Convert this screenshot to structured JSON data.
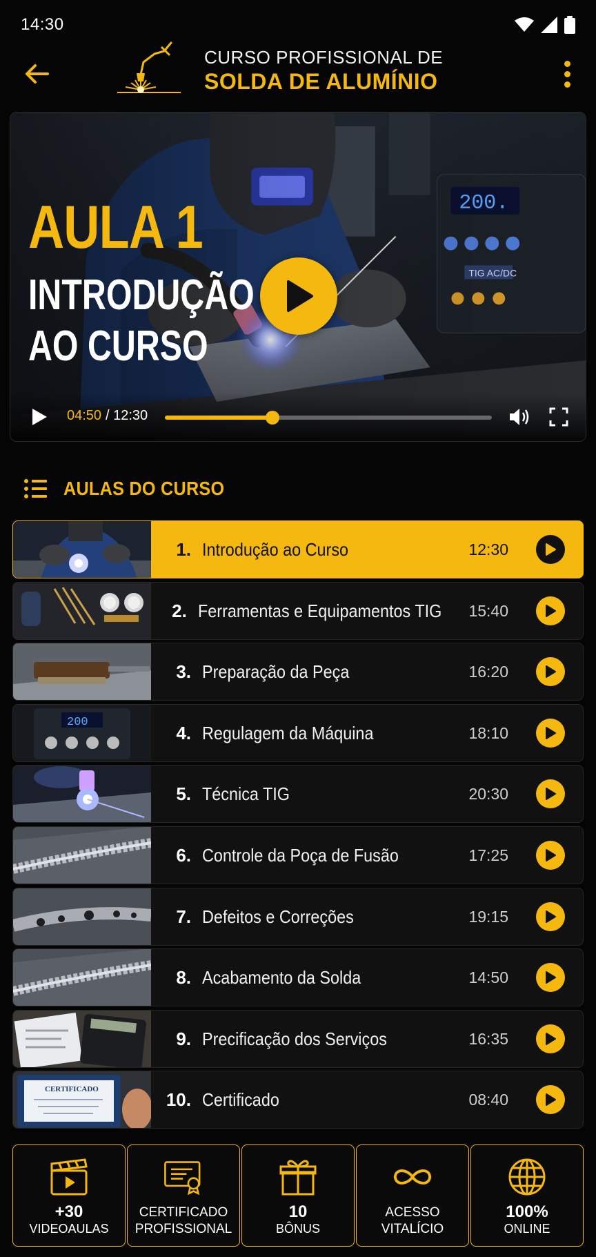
{
  "status_bar": {
    "time": "14:30"
  },
  "header": {
    "title_line1": "CURSO PROFISSIONAL DE",
    "title_line2": "SOLDA DE ALUMÍNIO"
  },
  "video": {
    "aula_label": "AULA 1",
    "subtitle_line1": "INTRODUÇÃO",
    "subtitle_line2": "AO CURSO",
    "machine_display": "200.",
    "machine_label": "TIG AC/DC",
    "current_time": "04:50",
    "time_separator_total": "/ 12:30",
    "progress": 0.33
  },
  "section": {
    "title": "AULAS DO CURSO"
  },
  "lessons": [
    {
      "num": "1.",
      "title": "Introdução ao Curso",
      "duration": "12:30",
      "active": true,
      "thumb": "welding"
    },
    {
      "num": "2.",
      "title": "Ferramentas e Equipamentos TIG",
      "duration": "15:40",
      "active": false,
      "thumb": "tools"
    },
    {
      "num": "3.",
      "title": "Preparação da Peça",
      "duration": "16:20",
      "active": false,
      "thumb": "brush"
    },
    {
      "num": "4.",
      "title": "Regulagem da Máquina",
      "duration": "18:10",
      "active": false,
      "thumb": "machine"
    },
    {
      "num": "5.",
      "title": "Técnica TIG",
      "duration": "20:30",
      "active": false,
      "thumb": "arc"
    },
    {
      "num": "6.",
      "title": "Controle da Poça de Fusão",
      "duration": "17:25",
      "active": false,
      "thumb": "bead"
    },
    {
      "num": "7.",
      "title": "Defeitos e Correções",
      "duration": "19:15",
      "active": false,
      "thumb": "defects"
    },
    {
      "num": "8.",
      "title": "Acabamento da Solda",
      "duration": "14:50",
      "active": false,
      "thumb": "bead"
    },
    {
      "num": "9.",
      "title": "Precificação dos Serviços",
      "duration": "16:35",
      "active": false,
      "thumb": "calculator"
    },
    {
      "num": "10.",
      "title": "Certificado",
      "duration": "08:40",
      "active": false,
      "thumb": "certificate"
    }
  ],
  "features": [
    {
      "big": "+30",
      "small": "VIDEOAULAS",
      "icon": "clapperboard-icon"
    },
    {
      "big": "",
      "small": "CERTIFICADO PROFISSIONAL",
      "icon": "certificate-icon"
    },
    {
      "big": "10",
      "small": "BÔNUS",
      "icon": "gift-icon"
    },
    {
      "big": "",
      "small": "ACESSO VITALÍCIO",
      "icon": "infinity-icon"
    },
    {
      "big": "100%",
      "small": "ONLINE",
      "icon": "globe-icon"
    }
  ],
  "colors": {
    "accent": "#f5b80f",
    "background": "#050505",
    "card": "#111111"
  },
  "thumb_certificate_text": "CERTIFICADO"
}
